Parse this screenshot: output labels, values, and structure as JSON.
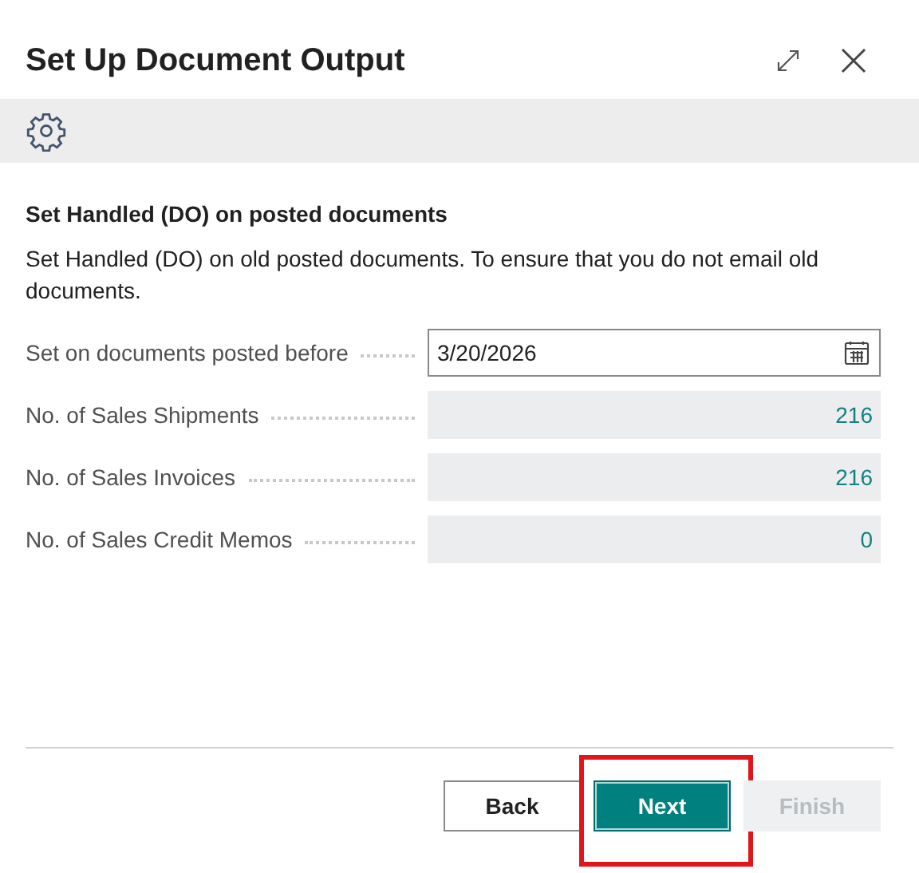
{
  "window": {
    "title": "Set Up Document Output"
  },
  "section": {
    "heading": "Set Handled (DO) on posted documents",
    "description": "Set Handled (DO) on old posted documents. To ensure that you do not email old documents."
  },
  "fields": [
    {
      "kind": "date",
      "label": "Set on documents posted before",
      "value": "3/20/2026"
    },
    {
      "kind": "readonly",
      "label": "No. of Sales Shipments",
      "value": "216"
    },
    {
      "kind": "readonly",
      "label": "No. of Sales Invoices",
      "value": "216"
    },
    {
      "kind": "readonly",
      "label": "No. of Sales Credit Memos",
      "value": "0"
    }
  ],
  "buttons": [
    {
      "label": "Back",
      "kind": "default",
      "disabled": false,
      "highlighted": false
    },
    {
      "label": "Next",
      "kind": "primary",
      "disabled": false,
      "highlighted": true
    },
    {
      "label": "Finish",
      "kind": "default",
      "disabled": true,
      "highlighted": false
    }
  ]
}
